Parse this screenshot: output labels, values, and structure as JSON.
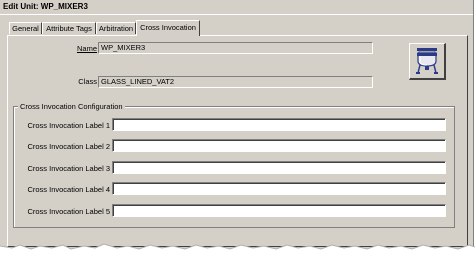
{
  "window": {
    "title": "Edit Unit:  WP_MIXER3"
  },
  "tabs": [
    {
      "label": "General"
    },
    {
      "label": "Attribute Tags"
    },
    {
      "label": "Arbitration"
    },
    {
      "label": "Cross Invocation"
    }
  ],
  "fields": {
    "name_label": "Name",
    "name_value": "WP_MIXER3",
    "class_label": "Class",
    "class_value": "GLASS_LINED_VAT2"
  },
  "unit_icon": "glass-lined-vat-icon",
  "cross_invocation": {
    "group_title": "Cross Invocation Configuration",
    "labels": [
      {
        "label": "Cross Invocation Label 1",
        "value": ""
      },
      {
        "label": "Cross Invocation Label 2",
        "value": ""
      },
      {
        "label": "Cross Invocation Label 3",
        "value": ""
      },
      {
        "label": "Cross Invocation Label 4",
        "value": ""
      },
      {
        "label": "Cross Invocation Label 5",
        "value": ""
      }
    ]
  },
  "colors": {
    "face": "#d4d0c8",
    "highlight": "#ffffff",
    "shadow": "#808080",
    "dark_shadow": "#404040"
  }
}
